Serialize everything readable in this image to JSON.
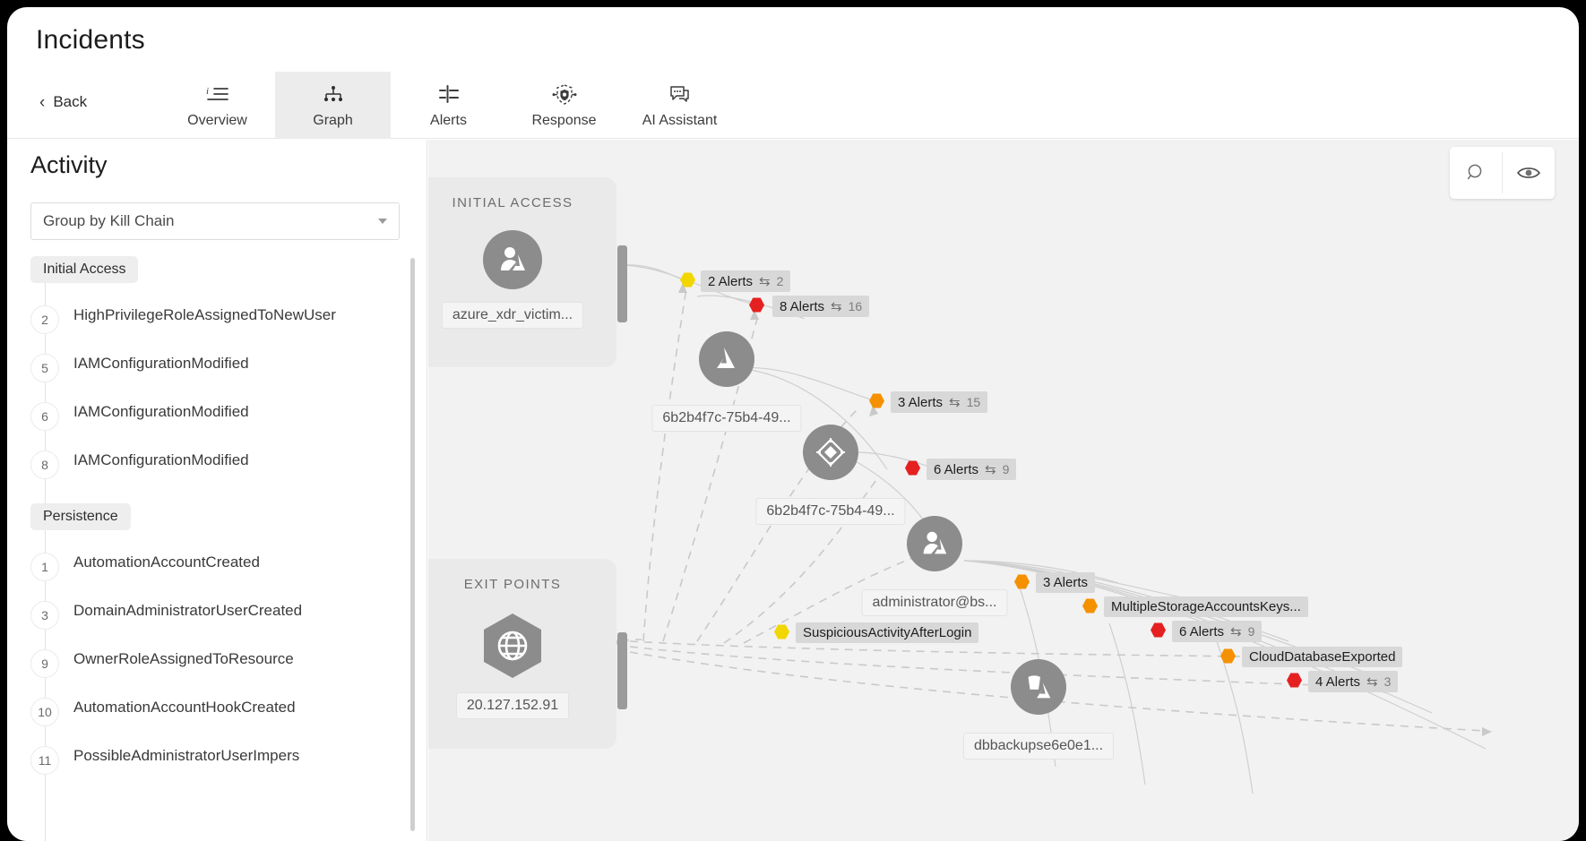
{
  "header": {
    "title": "Incidents",
    "back_label": "Back",
    "tabs": [
      {
        "label": "Overview",
        "icon": "list-icon",
        "active": false
      },
      {
        "label": "Graph",
        "icon": "graph-icon",
        "active": true
      },
      {
        "label": "Alerts",
        "icon": "alerts-icon",
        "active": false
      },
      {
        "label": "Response",
        "icon": "shield-icon",
        "active": false
      },
      {
        "label": "AI Assistant",
        "icon": "chat-icon",
        "active": false
      }
    ]
  },
  "sidebar": {
    "title": "Activity",
    "group_by": {
      "value": "Group by Kill Chain",
      "caret_icon": "chevron-down-icon"
    },
    "groups": [
      {
        "name": "Initial Access",
        "items": [
          {
            "num": "2",
            "label": "HighPrivilegeRoleAssignedToNewUser"
          },
          {
            "num": "5",
            "label": "IAMConfigurationModified"
          },
          {
            "num": "6",
            "label": "IAMConfigurationModified"
          },
          {
            "num": "8",
            "label": "IAMConfigurationModified"
          }
        ]
      },
      {
        "name": "Persistence",
        "items": [
          {
            "num": "1",
            "label": "AutomationAccountCreated"
          },
          {
            "num": "3",
            "label": "DomainAdministratorUserCreated"
          },
          {
            "num": "9",
            "label": "OwnerRoleAssignedToResource"
          },
          {
            "num": "10",
            "label": "AutomationAccountHookCreated"
          },
          {
            "num": "11",
            "label": "PossibleAdministratorUserImpers"
          }
        ]
      }
    ]
  },
  "graph": {
    "toolbar": [
      {
        "icon": "search-icon",
        "name": "search-button"
      },
      {
        "icon": "eye-icon",
        "name": "visibility-button"
      }
    ],
    "zones": [
      {
        "title": "INITIAL ACCESS",
        "icon": "azure-user-icon",
        "chip": "azure_xdr_victim..."
      },
      {
        "title": "EXIT POINTS",
        "icon": "globe-hexagon-icon",
        "chip": "20.127.152.91"
      }
    ],
    "nodes": [
      {
        "icon": "azure-icon",
        "chip": "6b2b4f7c-75b4-49..."
      },
      {
        "icon": "resource-icon",
        "chip": "6b2b4f7c-75b4-49..."
      },
      {
        "icon": "azure-user-icon",
        "chip": "administrator@bs..."
      },
      {
        "icon": "storage-bucket-icon",
        "chip": "dbbackupse6e0e1..."
      }
    ],
    "badges": [
      {
        "text": "2 Alerts",
        "swap": "⇆",
        "count": "2",
        "severity": "#f2d600"
      },
      {
        "text": "8 Alerts",
        "swap": "⇆",
        "count": "16",
        "severity": "#e52020"
      },
      {
        "text": "3 Alerts",
        "swap": "⇆",
        "count": "15",
        "severity": "#f59100"
      },
      {
        "text": "6 Alerts",
        "swap": "⇆",
        "count": "9",
        "severity": "#e52020"
      },
      {
        "text": "3 Alerts",
        "swap": "",
        "count": "",
        "severity": "#f59100"
      },
      {
        "text": "MultipleStorageAccountsKeys...",
        "swap": "",
        "count": "",
        "severity": "#f59100"
      },
      {
        "text": "6 Alerts",
        "swap": "⇆",
        "count": "9",
        "severity": "#e52020"
      },
      {
        "text": "SuspiciousActivityAfterLogin",
        "swap": "",
        "count": "",
        "severity": "#f2d600"
      },
      {
        "text": "CloudDatabaseExported",
        "swap": "",
        "count": "",
        "severity": "#f59100"
      },
      {
        "text": "4 Alerts",
        "swap": "⇆",
        "count": "3",
        "severity": "#e52020"
      }
    ]
  },
  "colors": {
    "severity_high": "#e52020",
    "severity_medium": "#f59100",
    "severity_low": "#f2d600",
    "canvas_bg": "#f2f2f2",
    "node_gray": "#8c8c8c"
  }
}
